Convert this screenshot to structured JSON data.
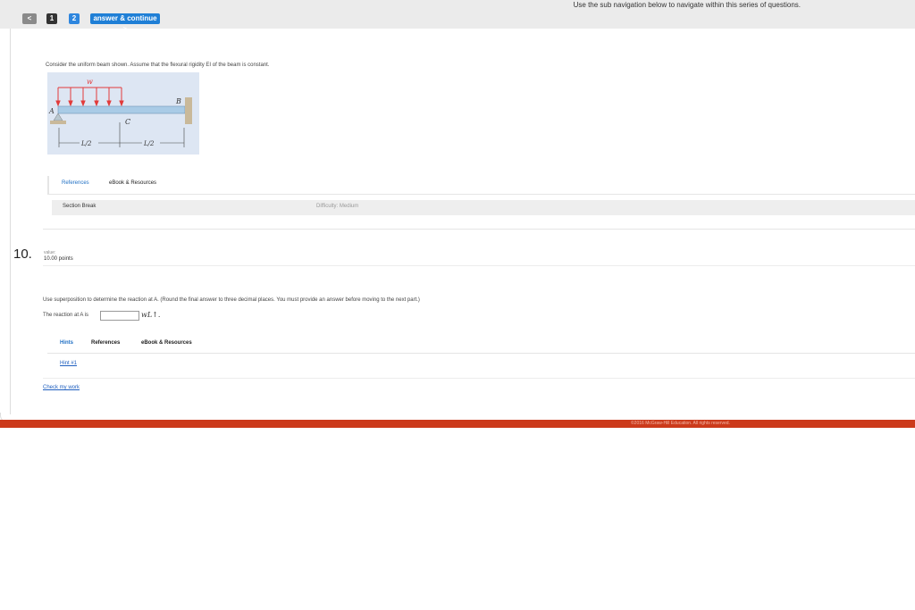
{
  "nav": {
    "subnav_hint": "Use the sub navigation below to navigate within this series of questions.",
    "back_glyph": "<",
    "q1": "1",
    "q2": "2",
    "continue_label": "answer & continue >"
  },
  "problem": {
    "intro": "Consider the uniform beam shown. Assume that the flexural rigidity EI of the beam is constant.",
    "figure": {
      "load_label": "w",
      "label_a": "A",
      "label_b": "B",
      "label_c": "C",
      "dim_left": "L/2",
      "dim_right": "L/2"
    }
  },
  "tabs1": {
    "references": "References",
    "ebook": "eBook & Resources"
  },
  "section_break": {
    "label": "Section Break",
    "difficulty": "Difficulty: Medium"
  },
  "question": {
    "number": "10.",
    "value_label": "value:",
    "points": "10.00 points",
    "prompt": "Use superposition to determine the reaction at A. (Round the final answer to three decimal places. You must provide an answer before moving to the next part.)",
    "answer_prefix": "The reaction at A is",
    "answer_value": "",
    "answer_unit": "wL↑."
  },
  "tabs2": {
    "hints": "Hints",
    "references": "References",
    "ebook": "eBook & Resources"
  },
  "hint_link": "Hint #1",
  "check_link": "Check my work",
  "footer": {
    "copyright": "©2016 McGraw-Hill Education. All rights reserved."
  },
  "colors": {
    "accent": "#1f7fd6",
    "footer": "#cc3a1b",
    "load_arrows": "#e23b3b"
  }
}
